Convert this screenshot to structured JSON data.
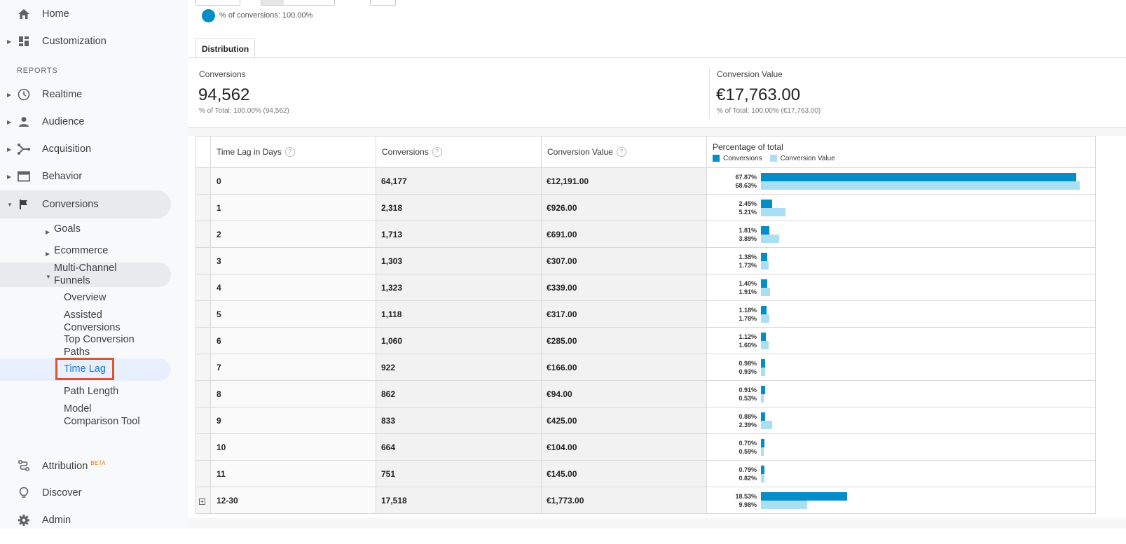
{
  "sidebar": {
    "home": "Home",
    "customization": "Customization",
    "reports_heading": "REPORTS",
    "realtime": "Realtime",
    "audience": "Audience",
    "acquisition": "Acquisition",
    "behavior": "Behavior",
    "conversions": "Conversions",
    "goals": "Goals",
    "ecommerce": "Ecommerce",
    "mcf_line1": "Multi-Channel",
    "mcf_line2": "Funnels",
    "overview": "Overview",
    "assisted_line1": "Assisted",
    "assisted_line2": "Conversions",
    "top_paths_line1": "Top Conversion",
    "top_paths_line2": "Paths",
    "time_lag": "Time Lag",
    "path_length": "Path Length",
    "model_line1": "Model",
    "model_line2": "Comparison Tool",
    "attribution": "Attribution",
    "attribution_badge": "BETA",
    "discover": "Discover",
    "admin": "Admin"
  },
  "chart_legend": "% of conversions: 100.00%",
  "tab": "Distribution",
  "summary": {
    "conversions_label": "Conversions",
    "conversions_value": "94,562",
    "conversions_sub": "% of Total: 100.00% (94,562)",
    "value_label": "Conversion Value",
    "value_value": "€17,763.00",
    "value_sub": "% of Total: 100.00% (€17,763.00)"
  },
  "table": {
    "headers": {
      "time_lag": "Time Lag in Days",
      "conversions": "Conversions",
      "conversion_value": "Conversion Value",
      "percentage": "Percentage of total",
      "legend_conversions": "Conversions",
      "legend_value": "Conversion Value"
    },
    "rows": [
      {
        "lag": "0",
        "conv": "64,177",
        "value": "€12,191.00",
        "pc": "67.87%",
        "pv": "68.63%",
        "fc": 67.87,
        "fv": 68.63
      },
      {
        "lag": "1",
        "conv": "2,318",
        "value": "€926.00",
        "pc": "2.45%",
        "pv": "5.21%",
        "fc": 2.45,
        "fv": 5.21
      },
      {
        "lag": "2",
        "conv": "1,713",
        "value": "€691.00",
        "pc": "1.81%",
        "pv": "3.89%",
        "fc": 1.81,
        "fv": 3.89
      },
      {
        "lag": "3",
        "conv": "1,303",
        "value": "€307.00",
        "pc": "1.38%",
        "pv": "1.73%",
        "fc": 1.38,
        "fv": 1.73
      },
      {
        "lag": "4",
        "conv": "1,323",
        "value": "€339.00",
        "pc": "1.40%",
        "pv": "1.91%",
        "fc": 1.4,
        "fv": 1.91
      },
      {
        "lag": "5",
        "conv": "1,118",
        "value": "€317.00",
        "pc": "1.18%",
        "pv": "1.78%",
        "fc": 1.18,
        "fv": 1.78
      },
      {
        "lag": "6",
        "conv": "1,060",
        "value": "€285.00",
        "pc": "1.12%",
        "pv": "1.60%",
        "fc": 1.12,
        "fv": 1.6
      },
      {
        "lag": "7",
        "conv": "922",
        "value": "€166.00",
        "pc": "0.98%",
        "pv": "0.93%",
        "fc": 0.98,
        "fv": 0.93
      },
      {
        "lag": "8",
        "conv": "862",
        "value": "€94.00",
        "pc": "0.91%",
        "pv": "0.53%",
        "fc": 0.91,
        "fv": 0.53
      },
      {
        "lag": "9",
        "conv": "833",
        "value": "€425.00",
        "pc": "0.88%",
        "pv": "2.39%",
        "fc": 0.88,
        "fv": 2.39
      },
      {
        "lag": "10",
        "conv": "664",
        "value": "€104.00",
        "pc": "0.70%",
        "pv": "0.59%",
        "fc": 0.7,
        "fv": 0.59
      },
      {
        "lag": "11",
        "conv": "751",
        "value": "€145.00",
        "pc": "0.79%",
        "pv": "0.82%",
        "fc": 0.79,
        "fv": 0.82
      },
      {
        "lag": "12-30",
        "conv": "17,518",
        "value": "€1,773.00",
        "pc": "18.53%",
        "pv": "9.98%",
        "fc": 18.53,
        "fv": 9.98,
        "expandable": true
      }
    ]
  },
  "colors": {
    "conversions_bar": "#058dc7",
    "value_bar": "#aadff3",
    "highlight_box": "#e0532f"
  }
}
